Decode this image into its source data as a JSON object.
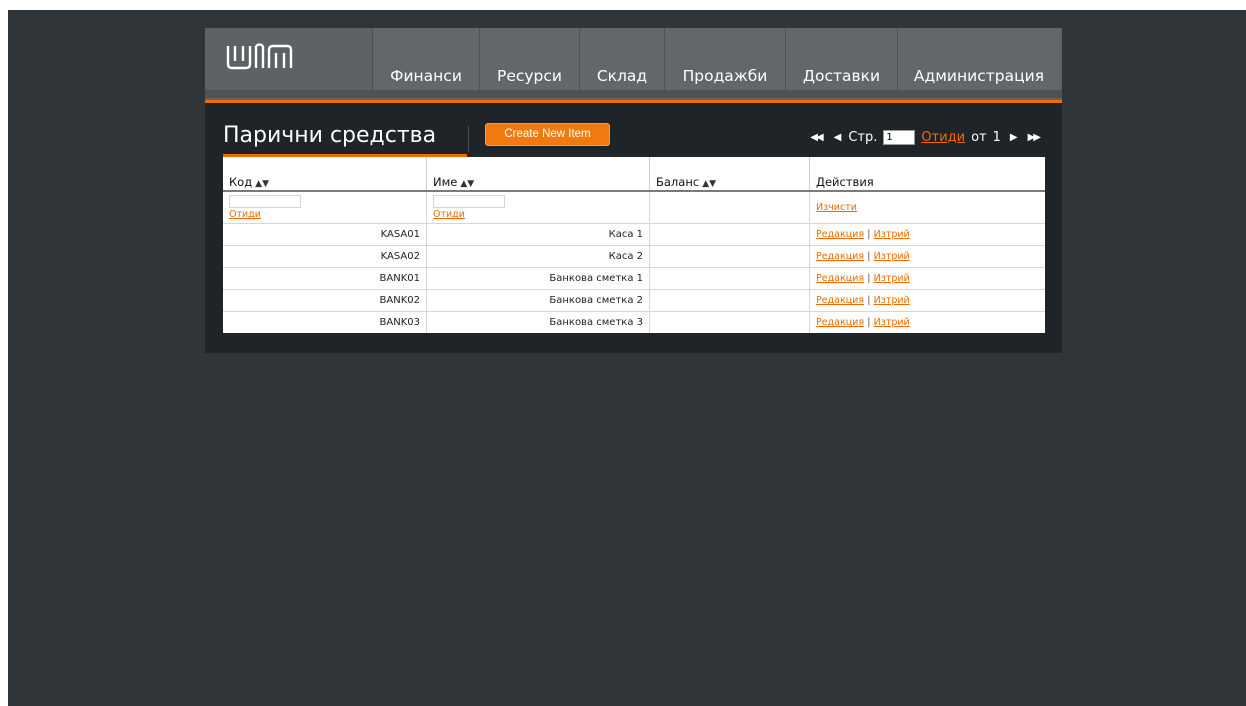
{
  "nav": {
    "items": [
      {
        "label": "Финанси"
      },
      {
        "label": "Ресурси"
      },
      {
        "label": "Склад"
      },
      {
        "label": "Продажби"
      },
      {
        "label": "Доставки"
      },
      {
        "label": "Администрация"
      }
    ]
  },
  "page": {
    "title": "Парични средства",
    "create_label": "Create New Item"
  },
  "pager": {
    "page_label": "Стр.",
    "page_value": "1",
    "go_label": "Отиди",
    "of_label": "от",
    "total_pages": "1"
  },
  "table": {
    "columns": [
      "Код",
      "Име",
      "Баланс",
      "Действия"
    ],
    "filter": {
      "go_label": "Отиди",
      "clear_label": "Изчисти"
    },
    "rows": [
      {
        "code": "KASA01",
        "name": "Каса 1",
        "balance": ""
      },
      {
        "code": "KASA02",
        "name": "Каса 2",
        "balance": ""
      },
      {
        "code": "BANK01",
        "name": "Банкова сметка 1",
        "balance": ""
      },
      {
        "code": "BANK02",
        "name": "Банкова сметка 2",
        "balance": ""
      },
      {
        "code": "BANK03",
        "name": "Банкова сметка 3",
        "balance": ""
      }
    ],
    "edit_label": "Редакция",
    "delete_label": "Изтрий",
    "separator": "|"
  },
  "colors": {
    "accent": "#f06c00",
    "frame": "#2f3538",
    "panel": "#1e2427",
    "topbar": "#5d6264"
  }
}
